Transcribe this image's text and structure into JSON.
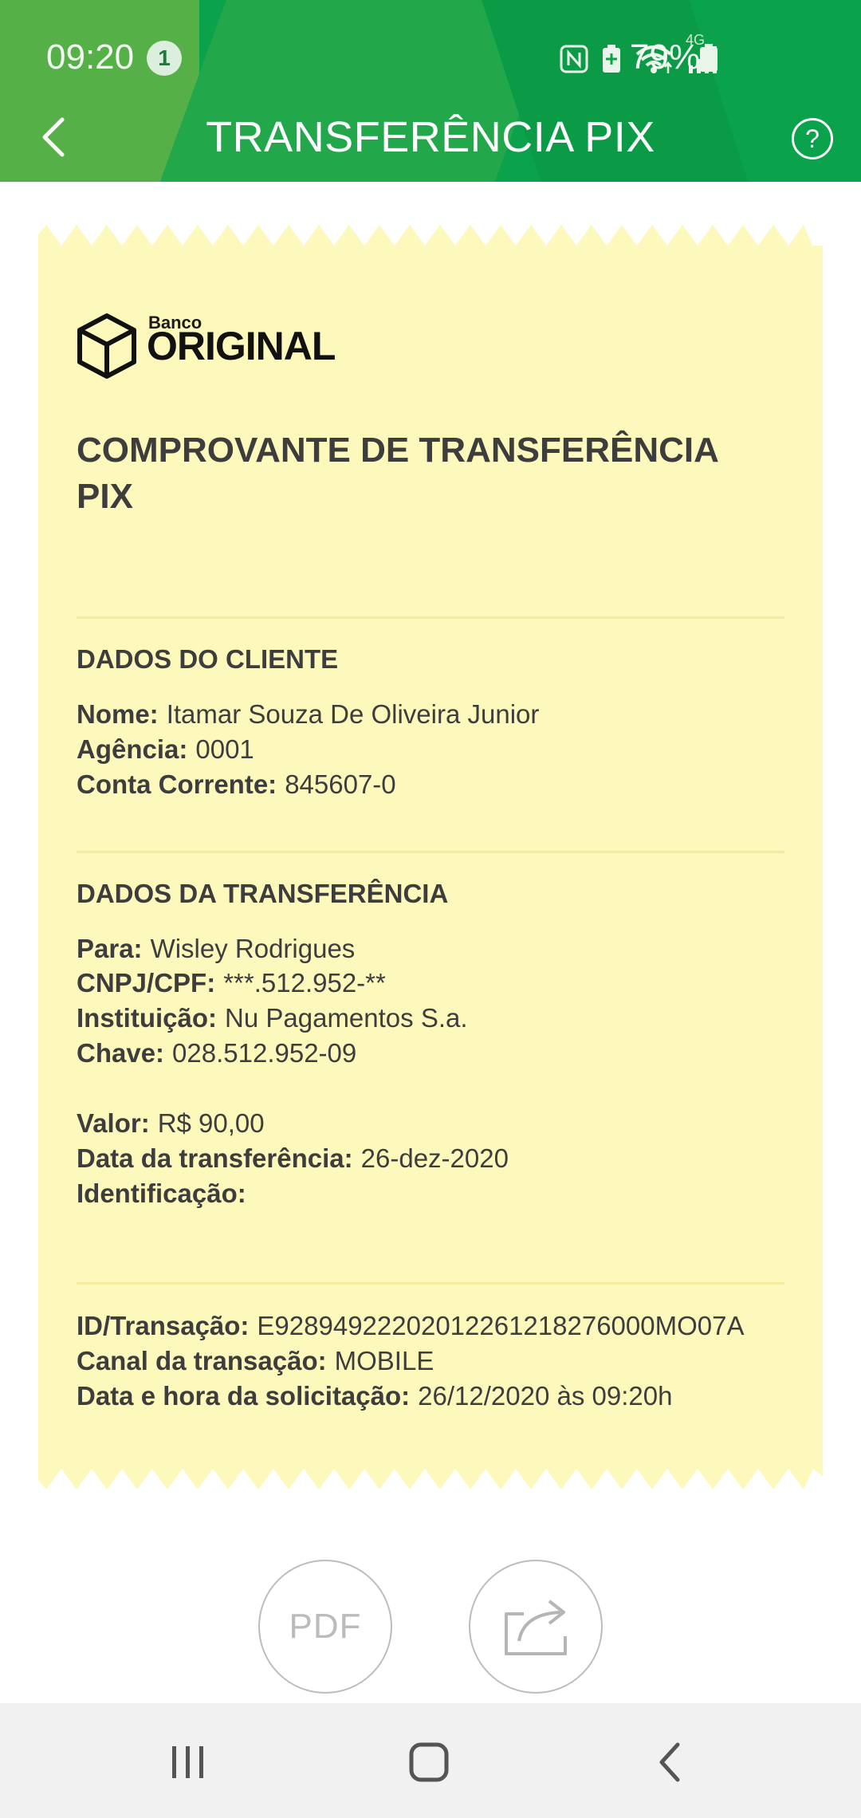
{
  "status_bar": {
    "time": "09:20",
    "notification_count": "1",
    "battery": "79%",
    "network_label": "4G"
  },
  "header": {
    "title": "TRANSFERÊNCIA PIX",
    "help_label": "?"
  },
  "colors": {
    "header_green": "#0aa24a",
    "receipt_yellow": "#fdf9bd",
    "text": "#3d3d3d"
  },
  "receipt": {
    "logo_small": "Banco",
    "logo_big": "ORIGINAL",
    "title_line1": "COMPROVANTE DE TRANSFERÊNCIA",
    "title_line2": "PIX",
    "client_section": {
      "title": "DADOS DO CLIENTE",
      "rows": [
        {
          "label": "Nome:",
          "value": "Itamar Souza De Oliveira Junior"
        },
        {
          "label": "Agência:",
          "value": "0001"
        },
        {
          "label": "Conta Corrente:",
          "value": "845607-0"
        }
      ]
    },
    "transfer_section": {
      "title": "DADOS DA TRANSFERÊNCIA",
      "rows": [
        {
          "label": "Para:",
          "value": "Wisley Rodrigues"
        },
        {
          "label": "CNPJ/CPF:",
          "value": "***.512.952-**"
        },
        {
          "label": "Instituição:",
          "value": "Nu Pagamentos S.a."
        },
        {
          "label": "Chave:",
          "value": "028.512.952-09"
        }
      ],
      "rows2": [
        {
          "label": "Valor:",
          "value": "R$ 90,00"
        },
        {
          "label": "Data da transferência:",
          "value": "26-dez-2020"
        },
        {
          "label": "Identificação:",
          "value": ""
        }
      ]
    },
    "transaction_section": {
      "rows": [
        {
          "label": "ID/Transação:",
          "value": "E92894922202012261218276000MO07A"
        },
        {
          "label": "Canal da transação:",
          "value": "MOBILE"
        },
        {
          "label": "Data e hora da solicitação:",
          "value": "26/12/2020 às 09:20h"
        }
      ]
    }
  },
  "actions": {
    "pdf_label": "PDF",
    "share_icon": "share-icon"
  },
  "navbar": {
    "recents_icon": "recents-icon",
    "home_icon": "home-icon",
    "back_icon": "back-icon"
  }
}
